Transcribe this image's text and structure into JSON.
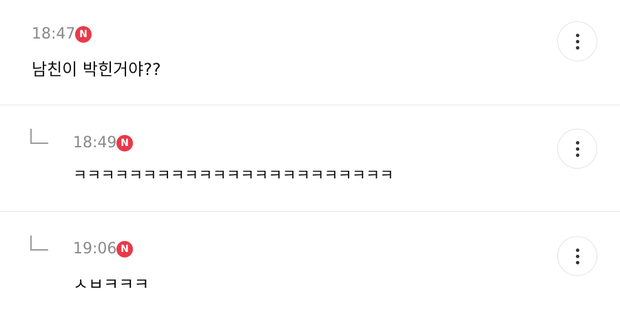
{
  "comments": [
    {
      "time": "18:47",
      "badge": "N",
      "text": "남친이 박힌거야??",
      "is_reply": false,
      "more_icon": "more-vertical-icon"
    },
    {
      "time": "18:49",
      "badge": "N",
      "text": "ㅋㅋㅋㅋㅋㅋㅋㅋㅋㅋㅋㅋㅋㅋㅋㅋㅋㅋㅋㅋㅋㅋㅋ",
      "is_reply": true,
      "reply_icon": "reply-arrow-icon",
      "more_icon": "more-vertical-icon"
    },
    {
      "time": "19:06",
      "badge": "N",
      "text": "ㅅㅂㅋㅋㅋ",
      "is_reply": true,
      "reply_icon": "reply-arrow-icon",
      "more_icon": "more-vertical-icon"
    }
  ],
  "colors": {
    "badge": "#e8394a",
    "time": "#8a8a8a",
    "text": "#111111",
    "divider": "#e6e6e6"
  }
}
